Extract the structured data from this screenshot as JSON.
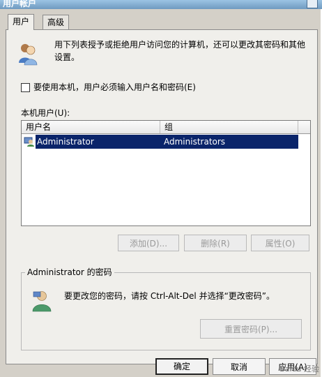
{
  "window": {
    "title": "用户帐户"
  },
  "tabs": [
    {
      "label": "用户",
      "active": true
    },
    {
      "label": "高级",
      "active": false
    }
  ],
  "intro": {
    "text": "用下列表授予或拒绝用户访问您的计算机，还可以更改其密码和其他设置。"
  },
  "checkbox": {
    "label": "要使用本机，用户必须输入用户名和密码(E)",
    "checked": false
  },
  "users_list": {
    "label": "本机用户(U):",
    "columns": [
      "用户名",
      "组"
    ],
    "rows": [
      {
        "user": "Administrator",
        "group": "Administrators",
        "selected": true
      }
    ]
  },
  "list_buttons": {
    "add": "添加(D)...",
    "remove": "删除(R)",
    "properties": "属性(O)"
  },
  "password_group": {
    "title": "Administrator 的密码",
    "text": "要更改您的密码，请按 Ctrl-Alt-Del 并选择“更改密码”。",
    "reset_button": "重置密码(P)..."
  },
  "footer_buttons": {
    "ok": "确定",
    "cancel": "取消",
    "apply": "应用(A)"
  },
  "watermark": "Baidu 经验",
  "colors": {
    "dialog_bg": "#d4d0c8",
    "panel_bg": "#f0efeb",
    "selection": "#0a246a",
    "disabled_text": "#9a9a9a"
  }
}
